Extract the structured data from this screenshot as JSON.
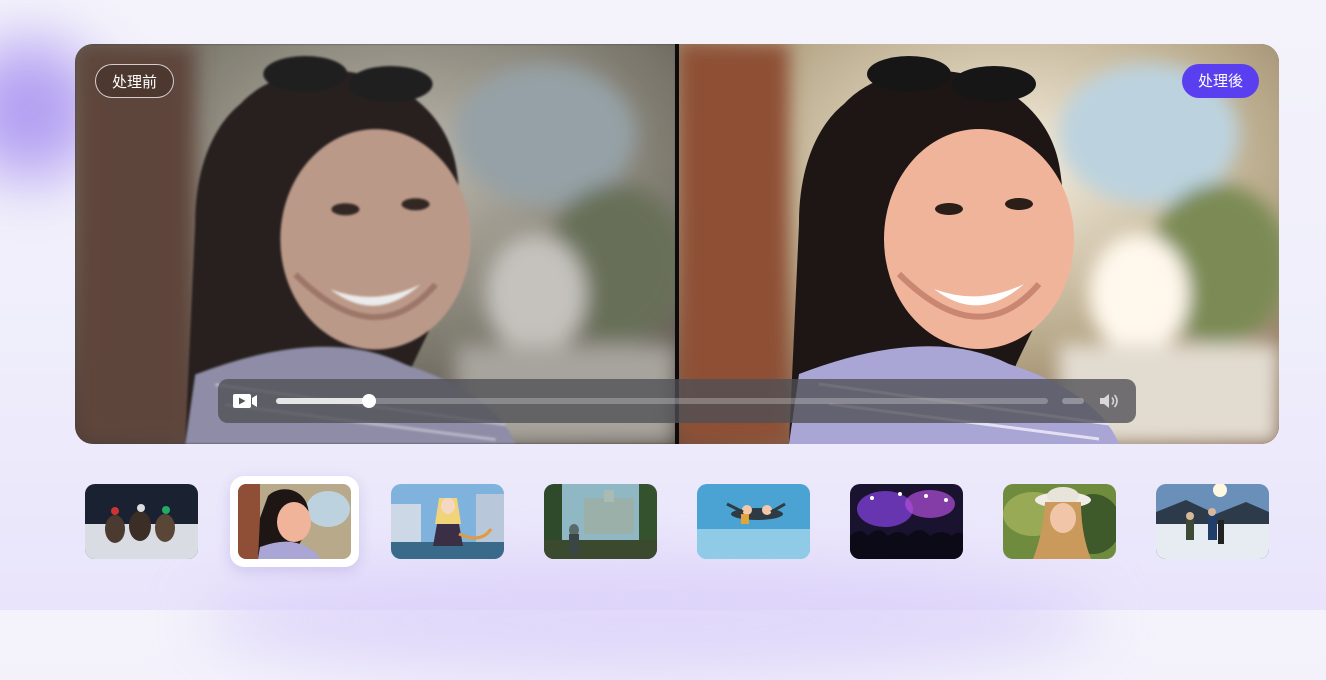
{
  "badges": {
    "before": "处理前",
    "after": "处理後"
  },
  "player": {
    "progress": 0.12,
    "icons": {
      "camera": "video-camera-icon",
      "volume": "volume-icon"
    }
  },
  "colors": {
    "accent": "#5a3ff0",
    "before_badge_border": "#ffffff",
    "controls_bg": "#505055"
  },
  "thumbnails": [
    {
      "id": "horse-race",
      "selected": false
    },
    {
      "id": "woman-portrait",
      "selected": true
    },
    {
      "id": "anime-girl",
      "selected": false
    },
    {
      "id": "game-soldier",
      "selected": false
    },
    {
      "id": "skydivers",
      "selected": false
    },
    {
      "id": "concert-crowd",
      "selected": false
    },
    {
      "id": "woman-hat",
      "selected": false
    },
    {
      "id": "snow-hikers",
      "selected": false
    }
  ]
}
